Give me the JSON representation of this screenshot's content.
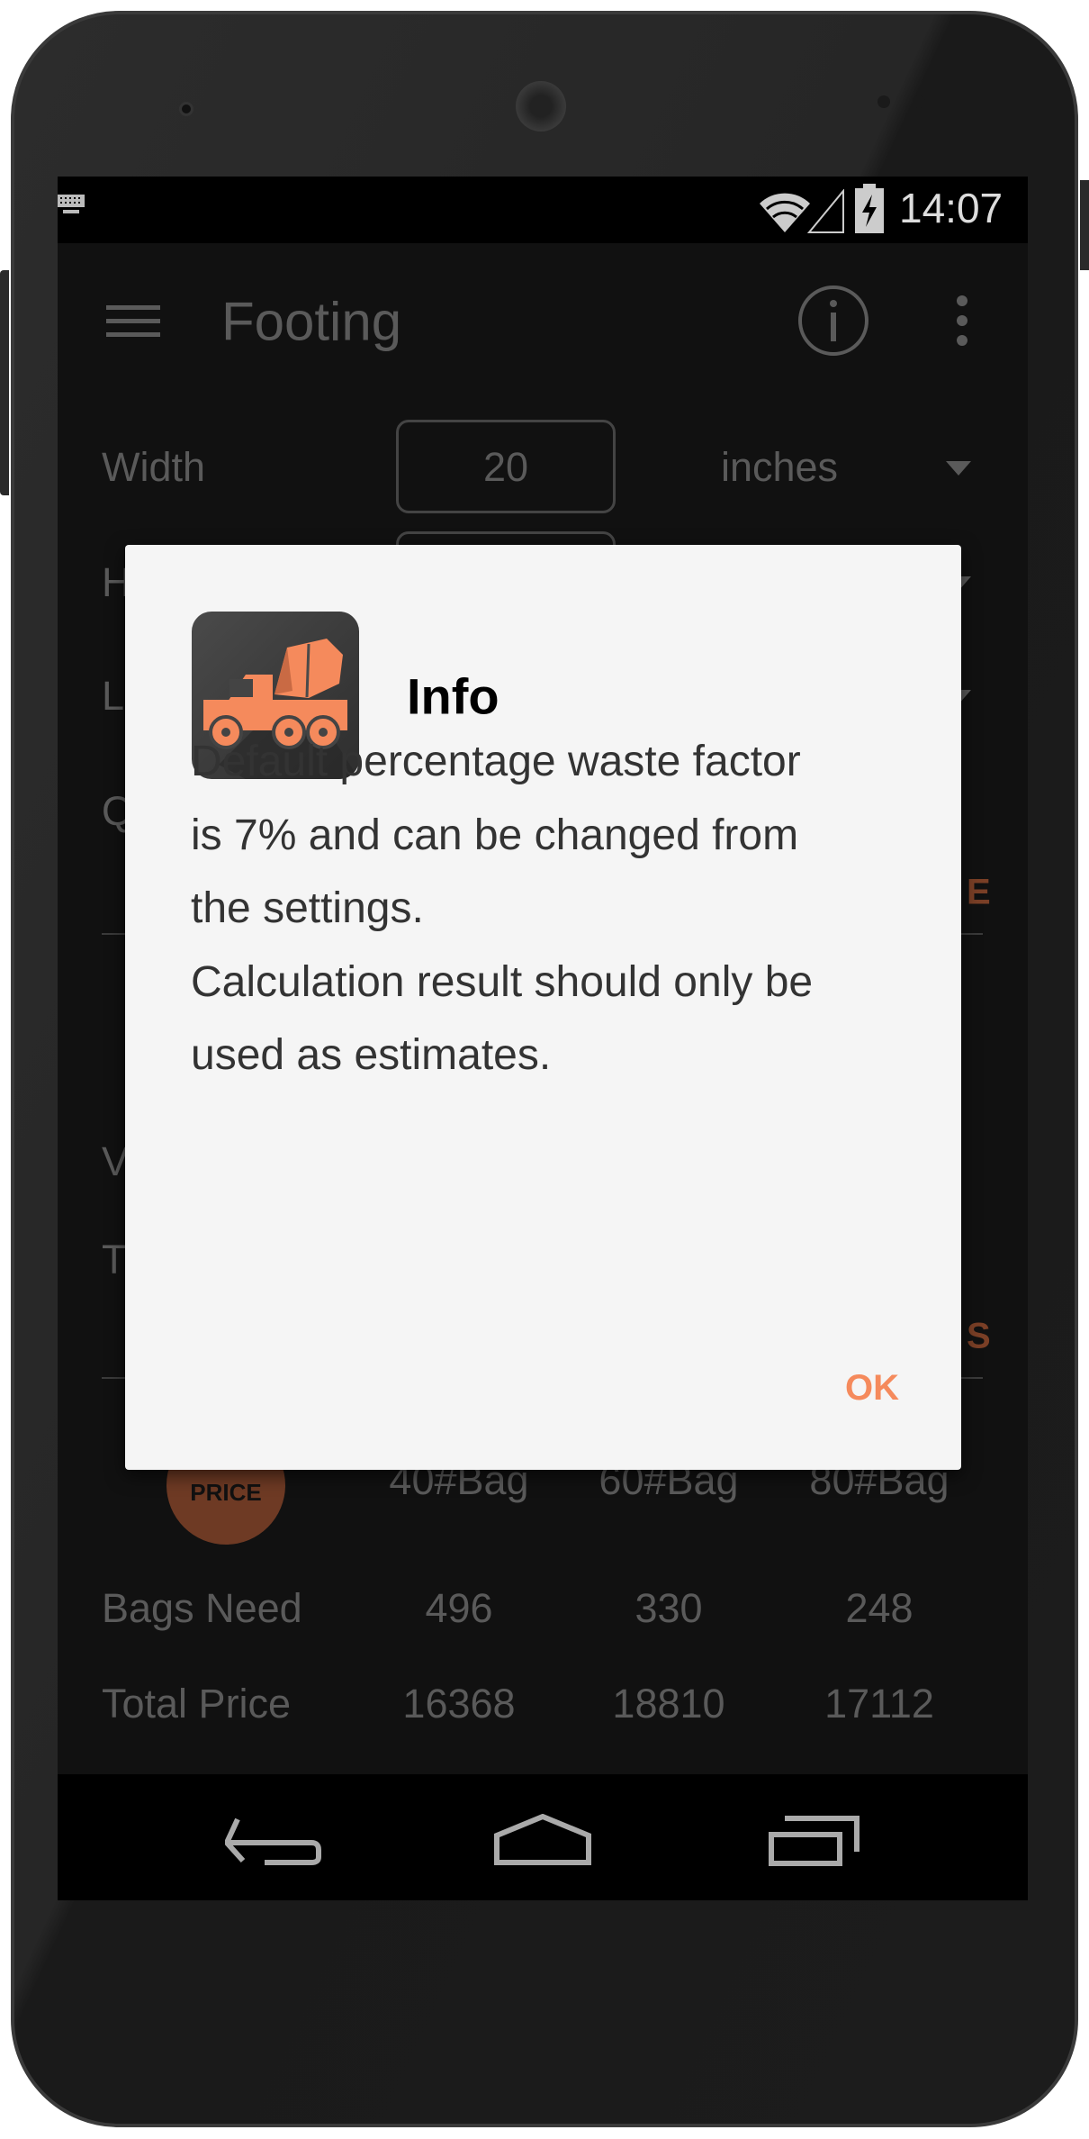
{
  "status_bar": {
    "time": "14:07",
    "icons": [
      "keyboard-icon",
      "wifi-icon",
      "signal-icon",
      "battery-charging-icon"
    ]
  },
  "app_bar": {
    "title": "Footing",
    "icons": [
      "menu-icon",
      "info-icon",
      "more-vert-icon"
    ]
  },
  "form": {
    "width": {
      "label": "Width",
      "value": "20",
      "unit": "inches"
    },
    "partial_labels": [
      "H",
      "L",
      "Q",
      "V",
      "T"
    ],
    "partial_buttons": [
      "E",
      "S"
    ]
  },
  "price_table": {
    "price_button": "PRICE",
    "columns": [
      "40#Bag",
      "60#Bag",
      "80#Bag"
    ],
    "rows": [
      {
        "label": "Bags Need",
        "values": [
          "496",
          "330",
          "248"
        ]
      },
      {
        "label": "Total Price",
        "values": [
          "16368",
          "18810",
          "17112"
        ]
      }
    ]
  },
  "dialog": {
    "title": "Info",
    "lines": [
      "Default percentage waste factor",
      "is 7% and can be changed from",
      "the settings.",
      "Calculation result should only be",
      "used as estimates."
    ],
    "ok_label": "OK"
  },
  "colors": {
    "accent": "#f58a5c",
    "dialog_bg": "#f5f5f5",
    "price_button": "#6e3a24"
  },
  "nav_bar": {
    "icons": [
      "back-icon",
      "home-icon",
      "recents-icon"
    ]
  }
}
